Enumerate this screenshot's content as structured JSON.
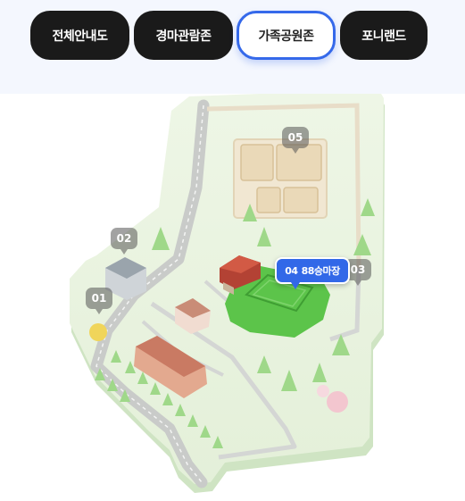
{
  "tabs": [
    {
      "label": "전체안내도",
      "active": false
    },
    {
      "label": "경마관람존",
      "active": false
    },
    {
      "label": "가족공원존",
      "active": true
    },
    {
      "label": "포니랜드",
      "active": false
    }
  ],
  "map": {
    "markers": [
      {
        "number": "01"
      },
      {
        "number": "02"
      },
      {
        "number": "03"
      },
      {
        "number": "05"
      }
    ],
    "selected_marker": {
      "number": "04",
      "name": "88승마장"
    }
  },
  "colors": {
    "accent": "#3268e8",
    "tab_dark": "#1a1a1a",
    "topbar_bg": "#f4f7fe",
    "map_grass": "#eaf4df",
    "selected_area": "#5cc44a"
  }
}
